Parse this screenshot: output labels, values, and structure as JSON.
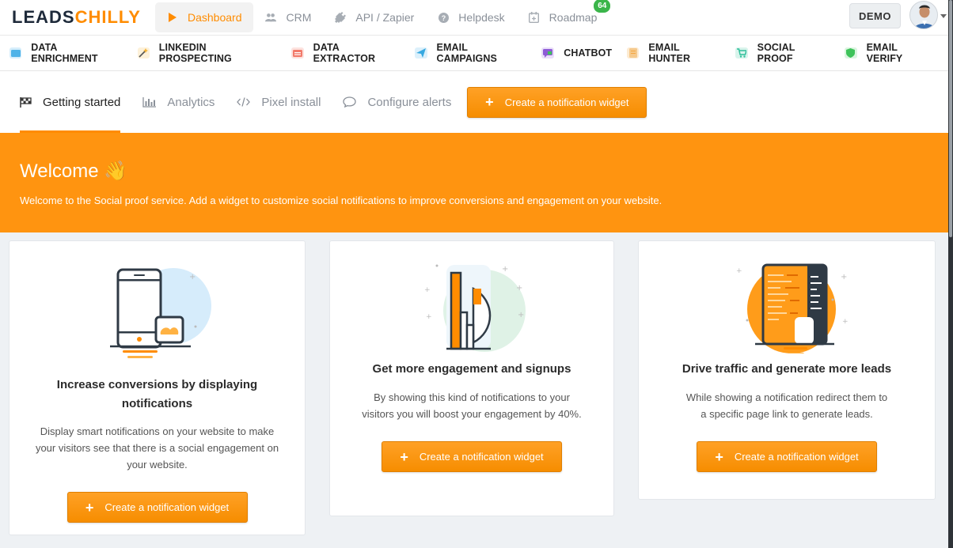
{
  "brand": {
    "part1": "LEADS",
    "part2": "CHILLY"
  },
  "topnav": [
    {
      "label": "Dashboard",
      "icon": "play-icon",
      "active": true
    },
    {
      "label": "CRM",
      "icon": "users-icon",
      "active": false
    },
    {
      "label": "API / Zapier",
      "icon": "plug-icon",
      "active": false
    },
    {
      "label": "Helpdesk",
      "icon": "question-icon",
      "active": false
    },
    {
      "label": "Roadmap",
      "icon": "calendar-icon",
      "active": false,
      "badge": "64"
    }
  ],
  "account": {
    "demo_label": "DEMO"
  },
  "products": [
    {
      "label": "DATA ENRICHMENT",
      "color": "#4fb3e8"
    },
    {
      "label": "LINKEDIN PROSPECTING",
      "color": "#f2b134"
    },
    {
      "label": "DATA EXTRACTOR",
      "color": "#f27a6a"
    },
    {
      "label": "EMAIL CAMPAIGNS",
      "color": "#36a9e1"
    },
    {
      "label": "CHATBOT",
      "color": "#8e5bd6"
    },
    {
      "label": "EMAIL HUNTER",
      "color": "#f5a640"
    },
    {
      "label": "SOCIAL PROOF",
      "color": "#2fbf9a"
    },
    {
      "label": "EMAIL VERIFY",
      "color": "#3ec35a"
    }
  ],
  "tabs": [
    {
      "label": "Getting started",
      "icon": "flag-icon",
      "active": true
    },
    {
      "label": "Analytics",
      "icon": "bar-chart-icon",
      "active": false
    },
    {
      "label": "Pixel install",
      "icon": "code-icon",
      "active": false
    },
    {
      "label": "Configure alerts",
      "icon": "comment-icon",
      "active": false
    }
  ],
  "create_button_label": "Create a notification widget",
  "welcome": {
    "title": "Welcome",
    "emoji": "👋",
    "text": "Welcome to the Social proof service. Add a widget to customize social notifications to improve conversions and engagement on your website."
  },
  "cards": [
    {
      "title": "Increase conversions by displaying notifications",
      "text": "Display smart notifications on your website to make your visitors see that there is a social engagement on your website.",
      "button": "Create a notification widget"
    },
    {
      "title": "Get more engagement and signups",
      "text": "By showing this kind of notifications to your visitors you will boost your engagement by 40%.",
      "button": "Create a notification widget"
    },
    {
      "title": "Drive traffic and generate more leads",
      "text": "While showing a notification redirect them to a specific page link to generate leads.",
      "button": "Create a notification widget"
    }
  ],
  "colors": {
    "accent": "#ff8c00",
    "banner": "#ff9410",
    "badge": "#3bb54a"
  }
}
